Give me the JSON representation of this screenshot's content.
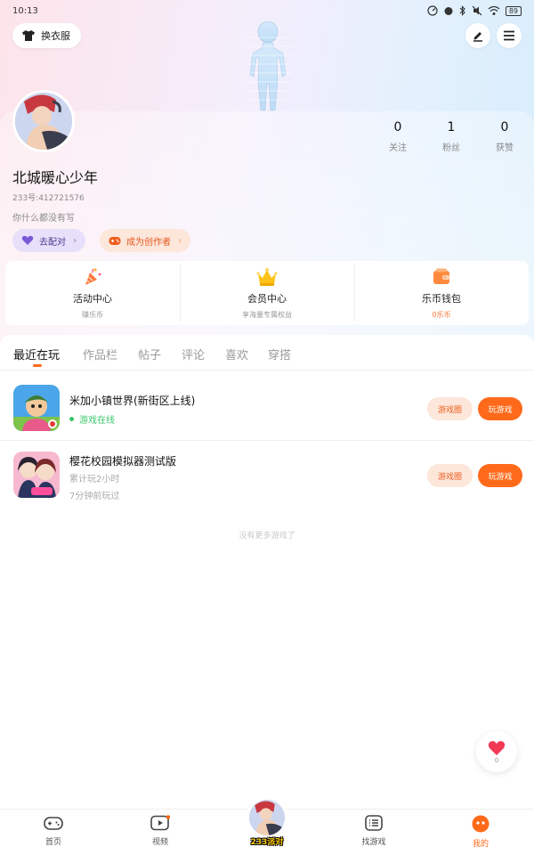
{
  "status_bar": {
    "time": "10:13",
    "battery": "89"
  },
  "header": {
    "skin_label": "换衣服"
  },
  "profile": {
    "nickname": "北城暖心少年",
    "uid": "233号:412721576",
    "bio": "你什么都没有写",
    "stats": [
      {
        "num": "0",
        "label": "关注"
      },
      {
        "num": "1",
        "label": "粉丝"
      },
      {
        "num": "0",
        "label": "获赞"
      }
    ],
    "pills": {
      "match": "去配对",
      "creator": "成为创作者"
    }
  },
  "services": [
    {
      "title": "活动中心",
      "sub": "赚乐币",
      "icon": "party-popper-icon"
    },
    {
      "title": "会员中心",
      "sub": "享海量专属权益",
      "icon": "crown-icon"
    },
    {
      "title": "乐币钱包",
      "sub": "0乐币",
      "icon": "wallet-icon"
    }
  ],
  "tabs": [
    "最近在玩",
    "作品栏",
    "帖子",
    "评论",
    "喜欢",
    "穿搭"
  ],
  "games": [
    {
      "title": "米加小镇世界(新街区上线)",
      "status": "游戏在线",
      "btn_circle": "游戏圈",
      "btn_play": "玩游戏"
    },
    {
      "title": "樱花校园模拟器测试版",
      "playtime": "累计玩2小时",
      "last_played": "7分钟前玩过",
      "btn_circle": "游戏圈",
      "btn_play": "玩游戏"
    }
  ],
  "no_more": "没有更多游戏了",
  "float_like": {
    "count": "0"
  },
  "bottom_nav": [
    {
      "label": "首页",
      "icon": "gamepad-icon"
    },
    {
      "label": "视频",
      "icon": "video-icon"
    },
    {
      "label": "233派对",
      "icon": "party-avatar-icon"
    },
    {
      "label": "找游戏",
      "icon": "list-icon"
    },
    {
      "label": "我的",
      "icon": "me-icon"
    }
  ],
  "colors": {
    "accent": "#ff6a1a",
    "online": "#3bc66b",
    "match_bg": "#e8e0fb",
    "creator_bg": "#fde6da"
  }
}
